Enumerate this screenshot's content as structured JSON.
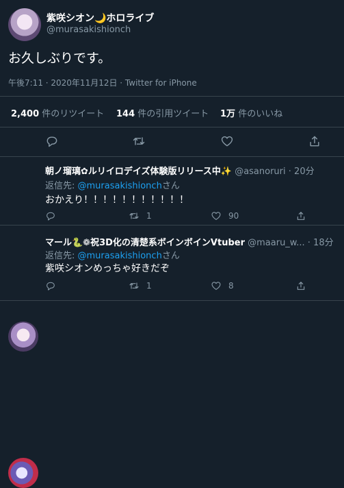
{
  "tweet": {
    "author_name": "紫咲シオン🌙ホロライブ",
    "author_handle": "@murasakishionch",
    "text": "お久しぶりです。",
    "meta": "午後7:11 · 2020年11月12日 · Twitter for iPhone",
    "stats": {
      "retweets_count": "2,400",
      "retweets_label": "件のリツイート",
      "quotes_count": "144",
      "quotes_label": "件の引用ツイート",
      "likes_count": "1万",
      "likes_label": "件のいいね"
    }
  },
  "replies": [
    {
      "name": "朝ノ瑠璃✿ルリイロデイズ体験版リリース中✨",
      "handle": "@asanoruri",
      "time": "· 20分",
      "reply_prefix": "返信先: ",
      "reply_to": "@murasakishionch",
      "reply_suffix": "さん",
      "text": "おかえり！！！！！！！！！！！",
      "retweet_count": "1",
      "like_count": "90"
    },
    {
      "name": "マール🐍❁祝3D化の清楚系ボインボインVtuber",
      "handle": "@maaru_w...",
      "time": "· 18分",
      "reply_prefix": "返信先: ",
      "reply_to": "@murasakishionch",
      "reply_suffix": "さん",
      "text": "紫咲シオンめっちゃ好きだぞ",
      "retweet_count": "1",
      "like_count": "8"
    }
  ],
  "colors": {
    "background": "#15202b",
    "accent": "#1da1f2",
    "muted": "#8899a6",
    "divider": "#38444d"
  },
  "icons": [
    "reply-icon",
    "retweet-icon",
    "like-icon",
    "share-icon"
  ]
}
